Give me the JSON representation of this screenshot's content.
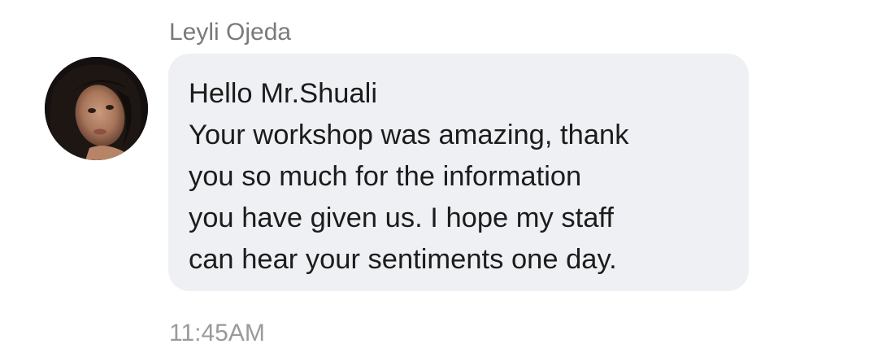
{
  "message": {
    "sender_name": "Leyli Ojeda",
    "avatar_icon": "profile-photo",
    "lines": [
      "Hello Mr.Shuali",
      "Your workshop was amazing, thank",
      "you so much for the information",
      "you have given us. I hope my staff",
      "can hear your sentiments one day."
    ],
    "timestamp": "11:45AM"
  },
  "colors": {
    "bubble_background": "#eef0f3",
    "text": "#1c1c1c",
    "secondary_text": "#7a7a7a"
  }
}
